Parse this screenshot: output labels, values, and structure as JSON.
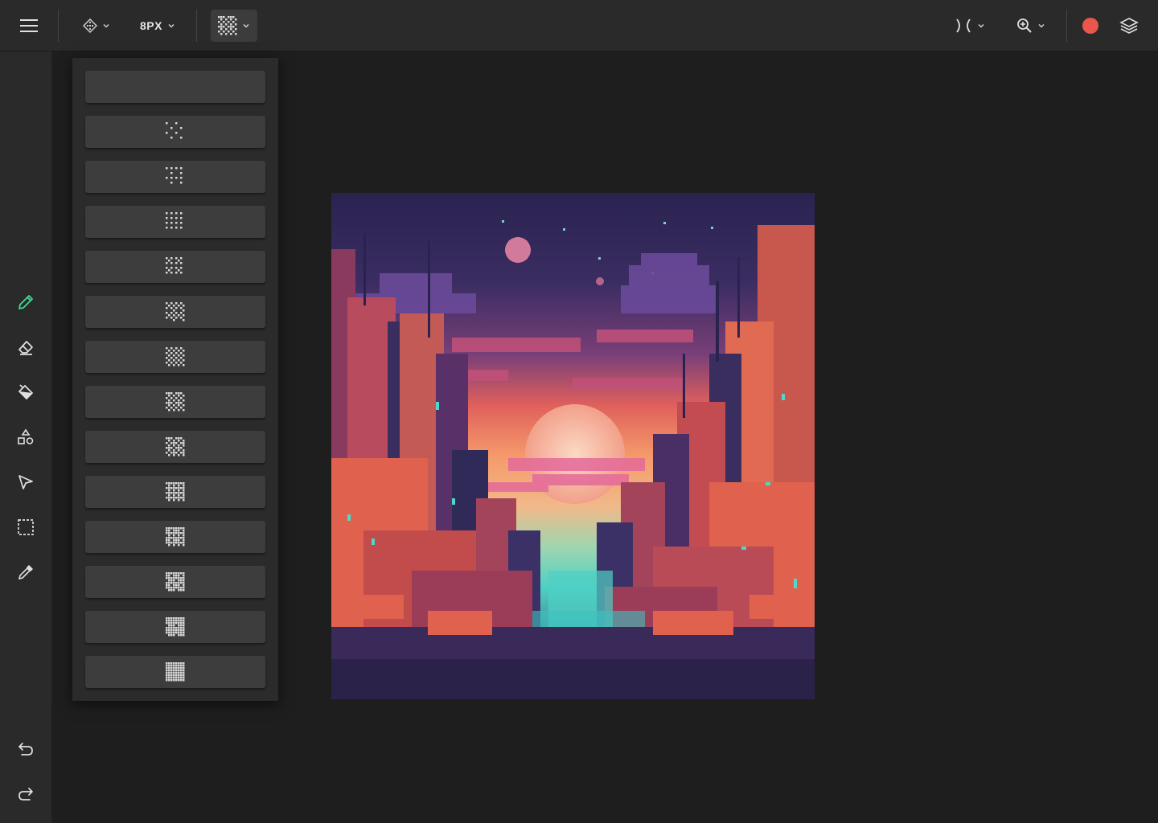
{
  "toolbar": {
    "menu_icon": "hamburger-menu-icon",
    "dither_icon": "dither-pattern-icon",
    "brush_size_label": "8PX",
    "pattern_icon": "checker-pattern-icon",
    "mirror_icon": "mirror-symmetry-icon",
    "zoom_icon": "zoom-in-icon",
    "color_swatch": "#e8564c",
    "layers_icon": "layers-icon"
  },
  "sidebar": {
    "tools": [
      {
        "name": "pencil",
        "icon": "pencil-icon",
        "active": true
      },
      {
        "name": "eraser",
        "icon": "eraser-icon"
      },
      {
        "name": "fill",
        "icon": "paint-bucket-icon"
      },
      {
        "name": "shapes",
        "icon": "shapes-icon"
      },
      {
        "name": "select",
        "icon": "pointer-icon"
      },
      {
        "name": "marquee",
        "icon": "marquee-select-icon"
      },
      {
        "name": "eyedropper",
        "icon": "eyedropper-icon"
      }
    ],
    "undo_icon": "undo-icon",
    "redo_icon": "redo-icon"
  },
  "dither_panel": {
    "pattern_levels": [
      0,
      1,
      2,
      3,
      4,
      5,
      6,
      7,
      8,
      9,
      10,
      11,
      12,
      13
    ]
  },
  "colors": {
    "accent_active_tool": "#3ddc97",
    "swatch": "#e8564c"
  }
}
